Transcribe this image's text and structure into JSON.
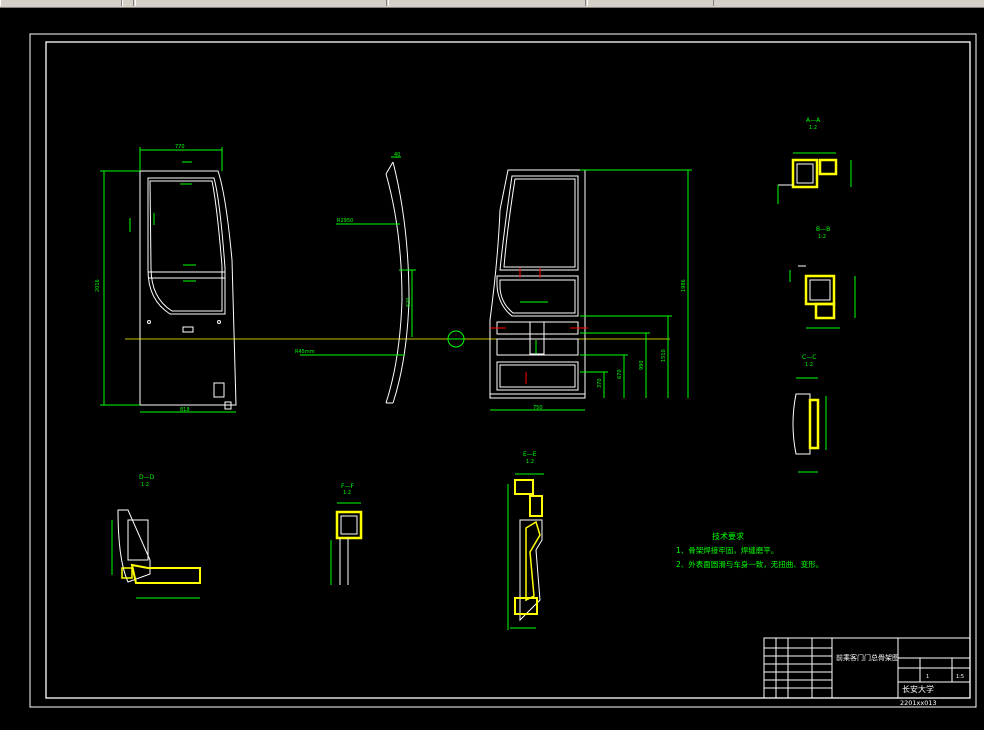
{
  "toolbar": {
    "segments": 5
  },
  "views": {
    "aa": {
      "label": "A—A",
      "scale": "1:2"
    },
    "bb": {
      "label": "B—B",
      "scale": "1:2"
    },
    "cc": {
      "label": "C—C",
      "scale": "1:2"
    },
    "dd": {
      "label": "D—D",
      "scale": "1:2"
    },
    "ff": {
      "label": "F—F",
      "scale": "1:2"
    },
    "ee": {
      "label": "E—E",
      "scale": "1:2"
    }
  },
  "dimensions": {
    "front_top": "770",
    "front_height": "2016",
    "front_bottom": "818",
    "side_top": "40",
    "side_r": "R2950",
    "side_h": "620",
    "side_r2": "R45mm",
    "rear_height": "1986",
    "rear_bottom": "750",
    "rear_d1": "1510",
    "rear_d2": "990",
    "rear_d3": "670",
    "rear_d4": "370"
  },
  "notes": {
    "title": "技术要求",
    "line1": "1、骨架焊接牢固，焊缝磨平。",
    "line2": "2、外表面圆滑与车身一致，无扭曲、变形。"
  },
  "title_block": {
    "drawing_name": "前乘客门门总骨架图",
    "school": "长安大学",
    "code": "2201xx013",
    "scale": "1:5",
    "qty": "1"
  },
  "colors": {
    "background": "#000000",
    "outline": "#ffffff",
    "dim": "#00ff00",
    "hatch": "#ffff00",
    "center": "#ffff00",
    "cut": "#ff0000"
  }
}
